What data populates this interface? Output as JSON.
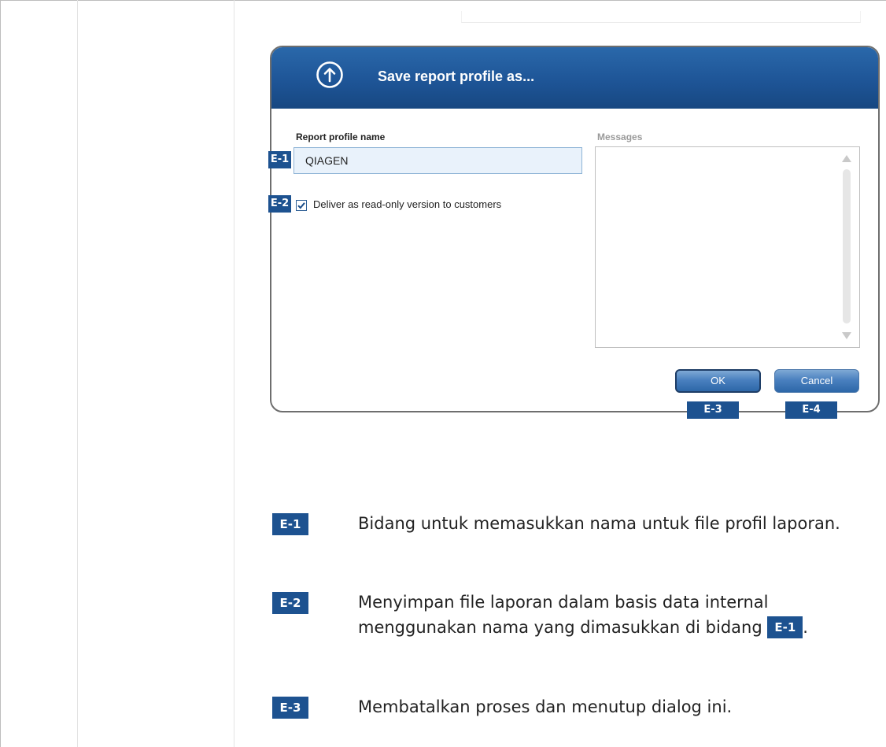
{
  "dialog": {
    "title": "Save report profile as...",
    "icon": "upload-circle-icon",
    "name_label": "Report profile name",
    "name_value": "QIAGEN",
    "checkbox_label": "Deliver as read-only version to customers",
    "checkbox_checked": true,
    "messages_label": "Messages",
    "ok_label": "OK",
    "cancel_label": "Cancel"
  },
  "badges": {
    "e1": "E-1",
    "e2": "E-2",
    "e3": "E-3",
    "e4": "E-4"
  },
  "legend": [
    {
      "badge": "E-1",
      "text": "Bidang untuk memasukkan nama untuk file profil laporan."
    },
    {
      "badge": "E-2",
      "text_before": "Menyimpan file laporan dalam basis data internal menggunakan nama yang dimasukkan di bidang",
      "inline_badge": "E-1",
      "text_after": "."
    },
    {
      "badge": "E-3",
      "text": "Membatalkan proses dan menutup dialog ini."
    }
  ],
  "colors": {
    "header_blue": "#1e5597",
    "badge_blue": "#1d5290",
    "input_bg": "#e9f2fb"
  }
}
